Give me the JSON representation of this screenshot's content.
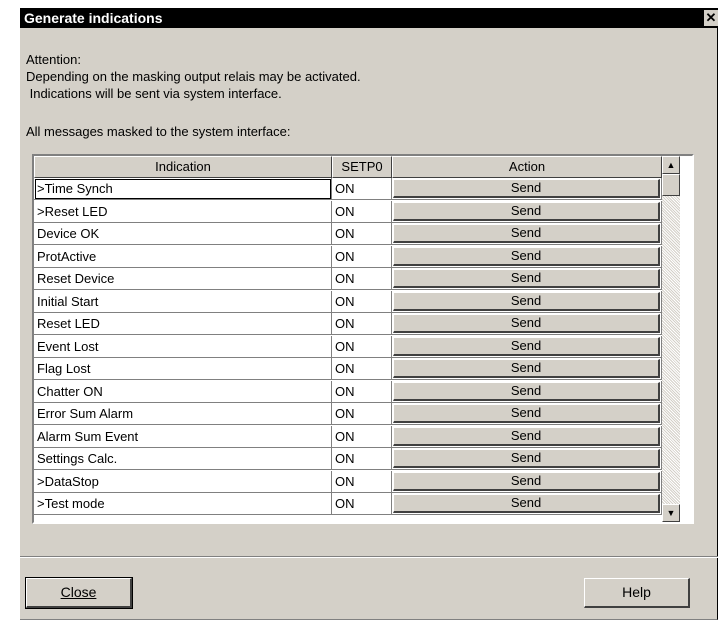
{
  "window": {
    "title": "Generate indications",
    "close_glyph": "✕"
  },
  "info": {
    "attention": "Attention:",
    "line1": "Depending on the masking output relais may be activated.",
    "line2": " Indications will be sent via system interface.",
    "list_caption": "All messages masked to the system interface:"
  },
  "table": {
    "columns": [
      "Indication",
      "SETP0",
      "Action"
    ],
    "rows": [
      {
        "indication": ">Time Synch",
        "setp0": "ON",
        "action": "Send"
      },
      {
        "indication": ">Reset LED",
        "setp0": "ON",
        "action": "Send"
      },
      {
        "indication": "Device OK",
        "setp0": "ON",
        "action": "Send"
      },
      {
        "indication": "ProtActive",
        "setp0": "ON",
        "action": "Send"
      },
      {
        "indication": "Reset Device",
        "setp0": "ON",
        "action": "Send"
      },
      {
        "indication": "Initial Start",
        "setp0": "ON",
        "action": "Send"
      },
      {
        "indication": "Reset LED",
        "setp0": "ON",
        "action": "Send"
      },
      {
        "indication": "Event Lost",
        "setp0": "ON",
        "action": "Send"
      },
      {
        "indication": "Flag Lost",
        "setp0": "ON",
        "action": "Send"
      },
      {
        "indication": "Chatter ON",
        "setp0": "ON",
        "action": "Send"
      },
      {
        "indication": "Error Sum Alarm",
        "setp0": "ON",
        "action": "Send"
      },
      {
        "indication": "Alarm Sum Event",
        "setp0": "ON",
        "action": "Send"
      },
      {
        "indication": "Settings Calc.",
        "setp0": "ON",
        "action": "Send"
      },
      {
        "indication": ">DataStop",
        "setp0": "ON",
        "action": "Send"
      },
      {
        "indication": ">Test mode",
        "setp0": "ON",
        "action": "Send"
      }
    ]
  },
  "scrollbar": {
    "up_glyph": "▲",
    "down_glyph": "▼"
  },
  "buttons": {
    "close": "Close",
    "help": "Help"
  },
  "icons": {
    "close": "close-icon",
    "scroll_up": "arrow-up-icon",
    "scroll_down": "arrow-down-icon"
  }
}
